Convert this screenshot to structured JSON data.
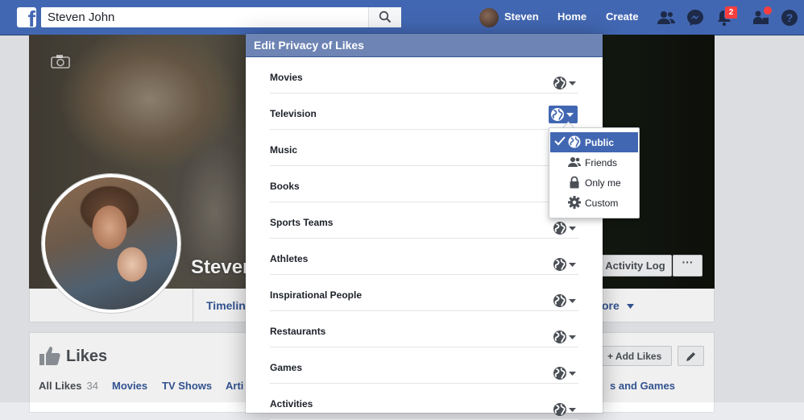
{
  "topbar": {
    "logo": "f",
    "search_value": "Steven John",
    "user_name": "Steven",
    "home": "Home",
    "create": "Create",
    "notifications_count": "2",
    "brand_color": "#4267b2"
  },
  "cover": {
    "profile_name": "Steven",
    "activity_log": "Activity Log",
    "more_dots": "···"
  },
  "profile_nav": {
    "timeline": "Timelin",
    "more": "ore"
  },
  "likes_section": {
    "title": "Likes",
    "add_likes": "Add Likes",
    "tabs": {
      "all": "All Likes",
      "all_count": "34",
      "movies": "Movies",
      "tv": "TV Shows",
      "arti": "Arti",
      "games": "s and Games"
    }
  },
  "dialog": {
    "title": "Edit Privacy of Likes",
    "header_color": "#6d84b4",
    "categories": [
      {
        "label": "Movies",
        "privacy": "globe-icon"
      },
      {
        "label": "Television",
        "privacy": "globe-icon"
      },
      {
        "label": "Music",
        "privacy": "globe-icon"
      },
      {
        "label": "Books",
        "privacy": "globe-icon"
      },
      {
        "label": "Sports Teams",
        "privacy": "globe-icon"
      },
      {
        "label": "Athletes",
        "privacy": "globe-icon"
      },
      {
        "label": "Inspirational People",
        "privacy": "globe-icon"
      },
      {
        "label": "Restaurants",
        "privacy": "globe-icon"
      },
      {
        "label": "Games",
        "privacy": "globe-icon"
      },
      {
        "label": "Activities",
        "privacy": "globe-icon"
      }
    ]
  },
  "privacy_menu": {
    "items": [
      {
        "label": "Public",
        "icon": "globe-icon",
        "selected": true
      },
      {
        "label": "Friends",
        "icon": "friends-icon"
      },
      {
        "label": "Only me",
        "icon": "lock-icon"
      },
      {
        "label": "Custom",
        "icon": "gear-icon"
      }
    ]
  }
}
